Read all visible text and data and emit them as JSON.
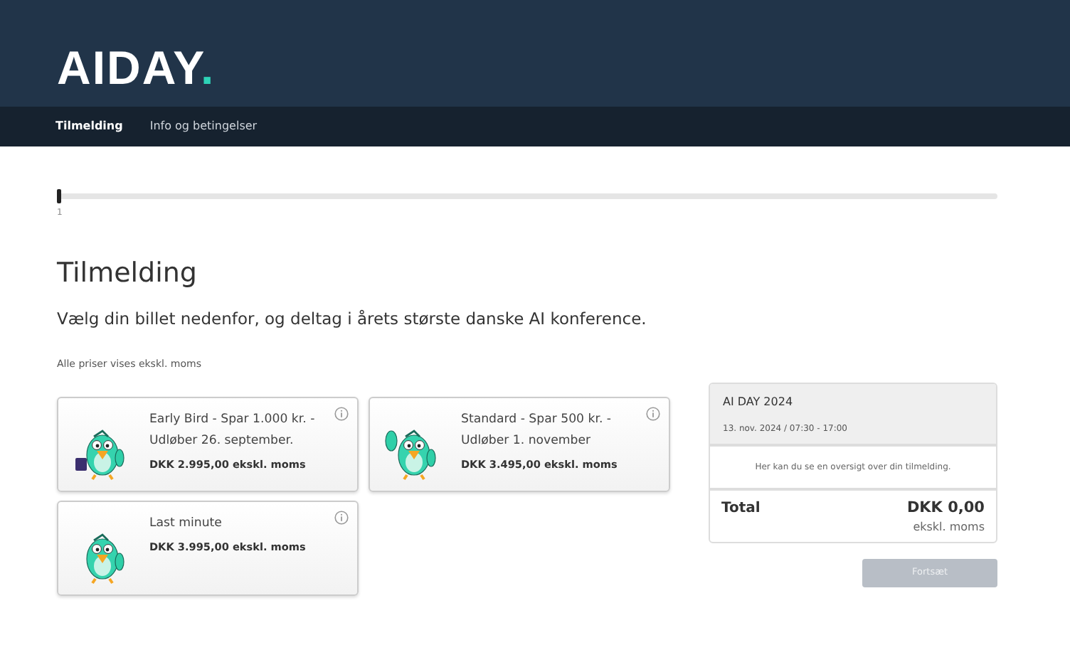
{
  "header": {
    "logo": "AIDAY",
    "logo_dot": "."
  },
  "nav": [
    {
      "label": "Tilmelding",
      "selected": true
    },
    {
      "label": "Info og betingelser",
      "selected": false
    }
  ],
  "progress": {
    "level": 0,
    "step": "1"
  },
  "title": "Tilmelding",
  "subtitle": "Vælg din billet nedenfor, og deltag i årets største danske AI konference.",
  "note": "Alle priser vises ekskl. moms",
  "tickets": [
    {
      "name": "Early Bird - Spar 1.000 kr. - Udløber 26. september.",
      "price": "DKK 2.995,00 ekskl. moms",
      "kind": "mug"
    },
    {
      "name": "Standard - Spar 500 kr. - Udløber 1. november",
      "price": "DKK 3.495,00 ekskl. moms",
      "kind": "wave"
    },
    {
      "name": "Last minute",
      "price": "DKK 3.995,00 ekskl. moms",
      "kind": "plain"
    }
  ],
  "summary": {
    "event": "AI DAY 2024",
    "date": "13. nov. 2024 / 07:30 - 17:00",
    "info": "Her kan du se en oversigt over din tilmelding.",
    "total_label": "Total",
    "total": "DKK 0,00",
    "total_note": "ekskl. moms"
  },
  "continue_button": {
    "label": "Fortsæt",
    "disabled": true
  }
}
